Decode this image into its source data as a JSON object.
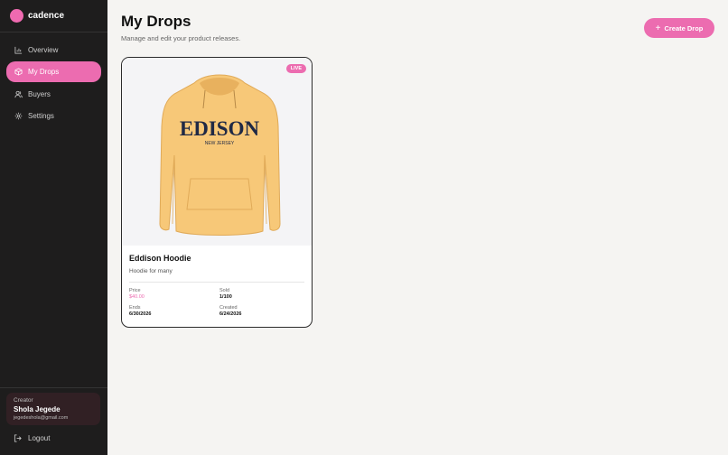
{
  "brand": {
    "name": "cadence"
  },
  "sidebar": {
    "items": [
      {
        "label": "Overview",
        "icon": "chart-icon"
      },
      {
        "label": "My Drops",
        "icon": "package-icon",
        "active": true
      },
      {
        "label": "Buyers",
        "icon": "users-icon"
      },
      {
        "label": "Settings",
        "icon": "gear-icon"
      }
    ]
  },
  "creator": {
    "role": "Creator",
    "name": "Shola Jegede",
    "email": "jegedeshola@gmail.com"
  },
  "logout": {
    "label": "Logout"
  },
  "page": {
    "title": "My Drops",
    "subtitle": "Manage and edit your product releases."
  },
  "actions": {
    "create_label": "Create Drop"
  },
  "drops": [
    {
      "status": "LIVE",
      "title": "Eddison Hoodie",
      "description": "Hoodie for many",
      "price_label": "Price",
      "price": "$40.00",
      "sold_label": "Sold",
      "sold": "1/100",
      "ends_label": "Ends",
      "ends": "6/30/2026",
      "created_label": "Created",
      "created": "6/24/2026",
      "image_text_main": "EDISON",
      "image_text_sub": "NEW JERSEY"
    }
  ],
  "colors": {
    "accent": "#ec6cb0",
    "sidebar": "#1e1d1d",
    "background": "#f5f4f2",
    "hoodie": "#f7c878"
  }
}
